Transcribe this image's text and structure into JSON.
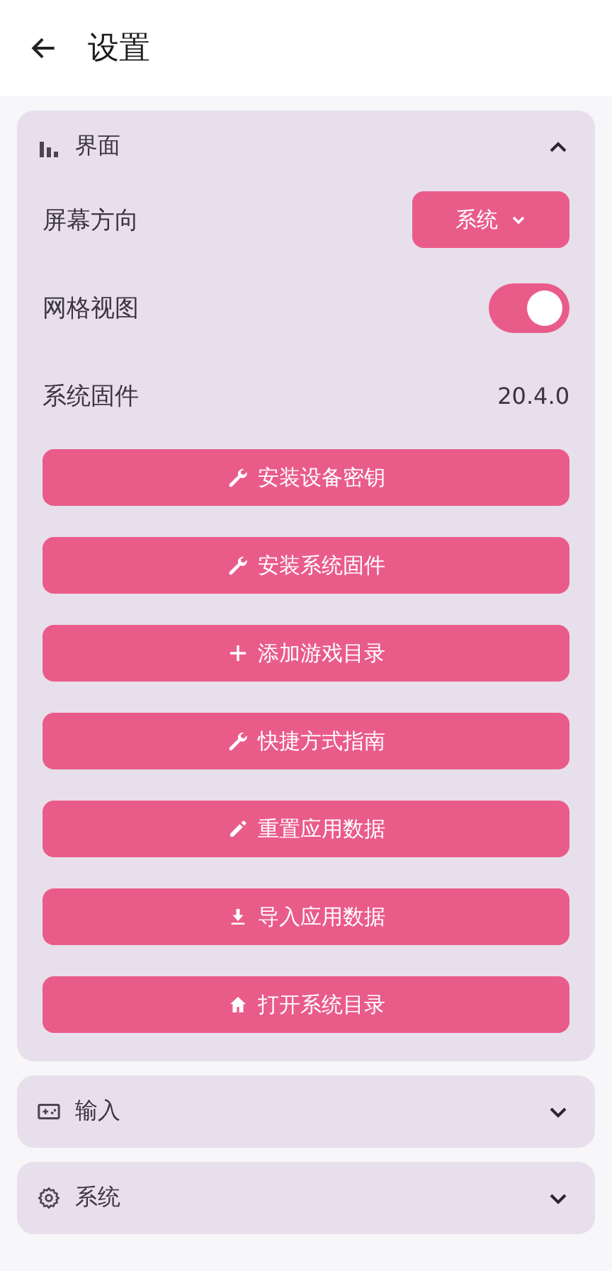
{
  "app_bar": {
    "title": "设置"
  },
  "sections": [
    {
      "title": "界面",
      "kind": "chart",
      "expanded": true,
      "rows": [
        {
          "kind": "dropdown",
          "label": "屏幕方向",
          "value": "系统"
        },
        {
          "kind": "switch",
          "label": "网格视图",
          "on": true
        },
        {
          "kind": "value",
          "label": "系统固件",
          "value": "20.4.0"
        }
      ],
      "buttons": [
        {
          "kind": "wrench",
          "label": "安装设备密钥"
        },
        {
          "kind": "wrench",
          "label": "安装系统固件"
        },
        {
          "kind": "plus",
          "label": "添加游戏目录"
        },
        {
          "kind": "wrench",
          "label": "快捷方式指南"
        },
        {
          "kind": "pencil",
          "label": "重置应用数据"
        },
        {
          "kind": "download",
          "label": "导入应用数据"
        },
        {
          "kind": "home",
          "label": "打开系统目录"
        }
      ]
    },
    {
      "title": "输入",
      "kind": "gamepad",
      "expanded": false
    },
    {
      "title": "系统",
      "kind": "gear",
      "expanded": false
    }
  ]
}
